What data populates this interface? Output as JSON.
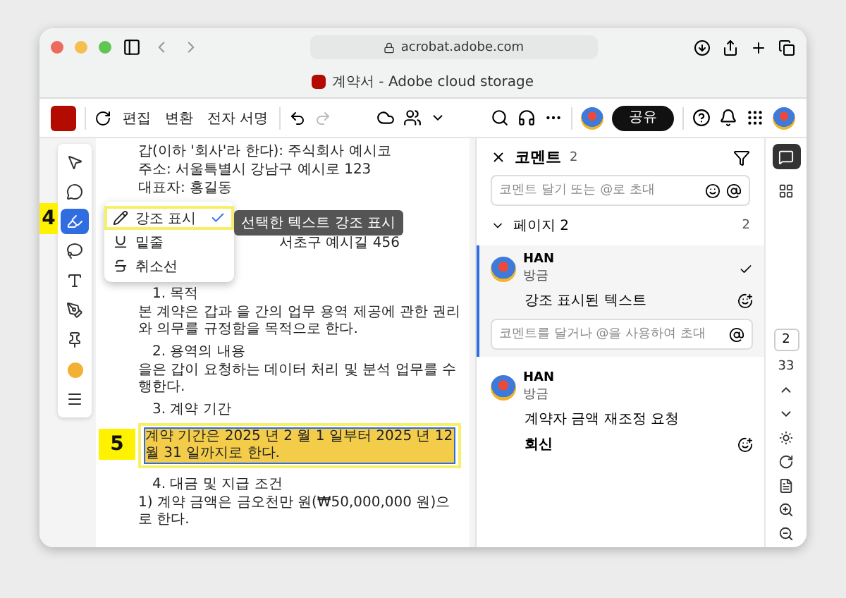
{
  "browser": {
    "url": "acrobat.adobe.com",
    "tab_title": "계약서 - Adobe cloud storage"
  },
  "toolbar": {
    "menus": [
      "편집",
      "변환",
      "전자 서명"
    ],
    "share_button": "공유"
  },
  "tools": [
    {
      "kind": "select",
      "selected": false
    },
    {
      "kind": "comment",
      "selected": false
    },
    {
      "kind": "highlight",
      "selected": true
    },
    {
      "kind": "lasso",
      "selected": false
    },
    {
      "kind": "textbox",
      "selected": false
    },
    {
      "kind": "sign",
      "selected": false
    },
    {
      "kind": "pin",
      "selected": false
    },
    {
      "kind": "color",
      "selected": false
    },
    {
      "kind": "menu",
      "selected": false
    }
  ],
  "highlight_menu": {
    "callout": "4",
    "tooltip": "선택한 텍스트 강조 표시",
    "items": [
      {
        "kind": "highlight",
        "label": "강조 표시",
        "checked": true
      },
      {
        "kind": "underline",
        "label": "밑줄",
        "checked": false
      },
      {
        "kind": "strike",
        "label": "취소선",
        "checked": false
      }
    ]
  },
  "document": {
    "lines": [
      {
        "kind": "text",
        "text": "갑(이하 '회사'라 한다): 주식회사 예시코"
      },
      {
        "kind": "text",
        "text": "주소: 서울특별시 강남구 예시로 123"
      },
      {
        "kind": "text",
        "text": "대표자: 홍길동"
      },
      {
        "kind": "address",
        "text": "서초구 예시길 456"
      },
      {
        "kind": "heading",
        "text": "1. 목적"
      },
      {
        "kind": "text",
        "text": "본 계약은 갑과 을 간의 업무 용역 제공에 관한 권리와 의무를 규정함을 목적으로 한다."
      },
      {
        "kind": "heading",
        "text": "2. 용역의 내용"
      },
      {
        "kind": "text",
        "text": "을은 갑이 요청하는 데이터 처리 및 분석 업무를 수행한다."
      },
      {
        "kind": "heading",
        "text": "3. 계약 기간"
      },
      {
        "kind": "selected",
        "text": "계약 기간은 2025 년 2 월 1 일부터 2025 년 12 월 31 일까지로 한다.",
        "callout": "5"
      },
      {
        "kind": "heading",
        "text": "4. 대금 및 지급 조건"
      },
      {
        "kind": "text",
        "text": "1) 계약 금액은 금오천만 원(₩50,000,000 원)으로 한다."
      }
    ]
  },
  "comments_panel": {
    "title": "코멘트",
    "count": "2",
    "placeholder": "코멘트 달기 또는 @로 초대",
    "page_group": {
      "label": "페이지 2",
      "count": "2",
      "expanded": true
    },
    "comments": [
      {
        "author": "HAN",
        "time": "방금",
        "text": "강조 표시된 텍스트",
        "selected": true,
        "reply_placeholder": "코멘트를 달거나 @을 사용하여 초대"
      },
      {
        "author": "HAN",
        "time": "방금",
        "text": "계약자 금액 재조정 요청",
        "selected": false,
        "reply_label": "회신"
      }
    ]
  },
  "right_rail": {
    "page": "2",
    "total": "33"
  }
}
